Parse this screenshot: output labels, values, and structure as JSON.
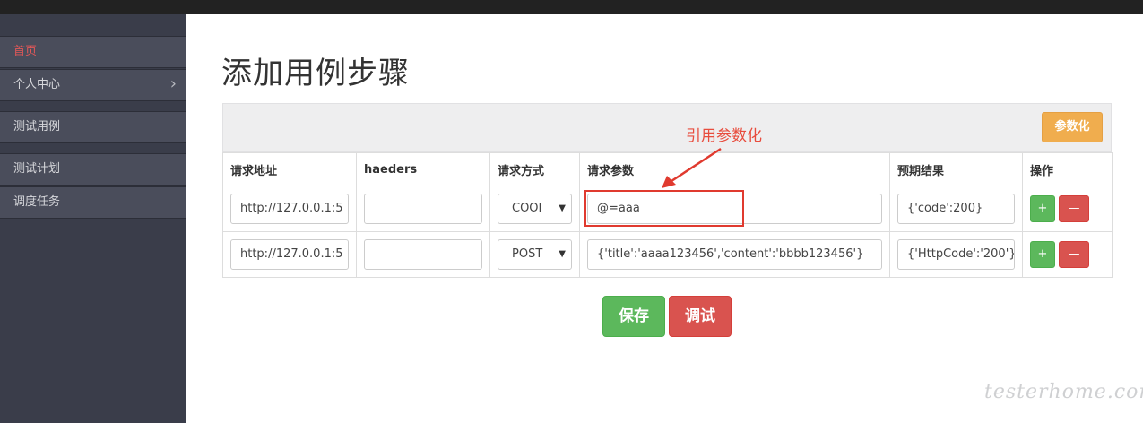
{
  "sidebar": {
    "items": [
      {
        "label": "首页",
        "active": true
      },
      {
        "label": "个人中心",
        "chevron": "›"
      },
      {
        "label": "测试用例"
      },
      {
        "label": "测试计划"
      },
      {
        "label": "调度任务"
      }
    ]
  },
  "page": {
    "title": "添加用例步骤",
    "param_button": "参数化",
    "annotation": "引用参数化"
  },
  "table": {
    "headers": [
      "请求地址",
      "haeders",
      "请求方式",
      "请求参数",
      "预期结果",
      "操作"
    ],
    "rows": [
      {
        "url": "http://127.0.0.1:5",
        "headers": "",
        "method": "COOI",
        "params": "@=aaa",
        "expected": "{'code':200}"
      },
      {
        "url": "http://127.0.0.1:5",
        "headers": "",
        "method": "POST",
        "params": "{'title':'aaaa123456','content':'bbbb123456'}",
        "expected": "{'HttpCode':'200'}"
      }
    ],
    "add_label": "+",
    "del_label": "—",
    "caret": "▼"
  },
  "actions": {
    "save": "保存",
    "debug": "调试"
  },
  "watermark": "testerhome.com",
  "colors": {
    "accent_red": "#d9534f",
    "success_green": "#5cb85c",
    "warning_orange": "#f0ad4e",
    "sidebar_bg": "#3a3d4a"
  }
}
